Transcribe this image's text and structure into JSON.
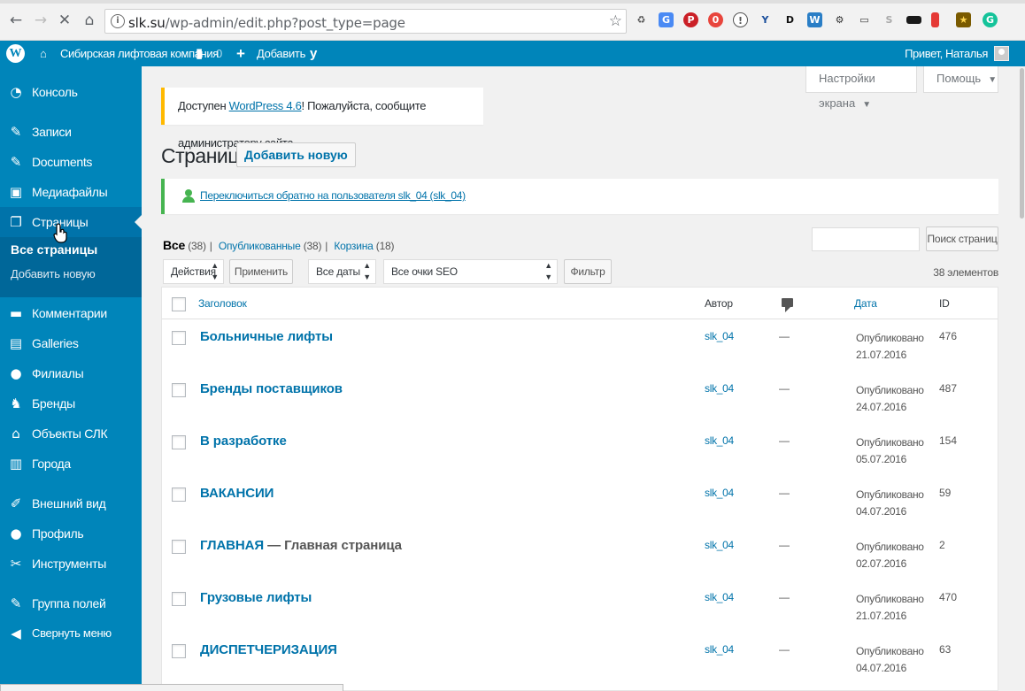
{
  "browser": {
    "url_host": "slk.su",
    "url_path": "/wp-admin/edit.php?post_type=page",
    "back_icon": "arrow-left-icon",
    "forward_icon": "arrow-right-icon",
    "stop_icon": "close-icon",
    "home_icon": "home-icon"
  },
  "adminbar": {
    "site_name": "Сибирская лифтовая компания",
    "comments_count": "0",
    "add_label": "Добавить",
    "greeting": "Привет, Наталья"
  },
  "sidebar": {
    "items": [
      {
        "label": "Консоль",
        "icon": "dashboard-icon"
      },
      {
        "label": "Записи",
        "icon": "pin-icon"
      },
      {
        "label": "Documents",
        "icon": "pin-icon"
      },
      {
        "label": "Медиафайлы",
        "icon": "media-icon"
      },
      {
        "label": "Страницы",
        "icon": "pages-icon"
      },
      {
        "label": "Комментарии",
        "icon": "comment-icon"
      },
      {
        "label": "Galleries",
        "icon": "gallery-icon"
      },
      {
        "label": "Филиалы",
        "icon": "location-icon"
      },
      {
        "label": "Бренды",
        "icon": "brand-icon"
      },
      {
        "label": "Объекты СЛК",
        "icon": "home-icon"
      },
      {
        "label": "Города",
        "icon": "building-icon"
      },
      {
        "label": "Внешний вид",
        "icon": "brush-icon"
      },
      {
        "label": "Профиль",
        "icon": "user-icon"
      },
      {
        "label": "Инструменты",
        "icon": "wrench-icon"
      },
      {
        "label": "Группа полей",
        "icon": "plugin-icon"
      },
      {
        "label": "Свернуть меню",
        "icon": "collapse-icon"
      }
    ],
    "submenu": {
      "all_pages": "Все страницы",
      "add_new": "Добавить новую"
    }
  },
  "screen_options": {
    "screen_label": "Настройки экрана",
    "help_label": "Помощь"
  },
  "update_notice": {
    "prefix": "Доступен ",
    "link": "WordPress 4.6",
    "suffix": "! Пожалуйста, сообщите администратору сайта."
  },
  "page": {
    "title": "Страницы",
    "add_new": "Добавить новую"
  },
  "switch_notice": {
    "link": "Переключиться обратно на пользователя slk_04 (slk_04)",
    "suffix": "."
  },
  "filters": {
    "all": "Все",
    "all_count": "(38)",
    "published": "Опубликованные",
    "published_count": "(38)",
    "trash": "Корзина",
    "trash_count": "(18)",
    "search_button": "Поиск страниц",
    "bulk_action": "Действия",
    "apply": "Применить",
    "dates": "Все даты",
    "seo": "Все очки SEO",
    "filter": "Фильтр",
    "count": "38 элементов"
  },
  "table": {
    "headers": {
      "title": "Заголовок",
      "author": "Автор",
      "date": "Дата",
      "id": "ID"
    },
    "rows": [
      {
        "title": "Больничные лифты",
        "state": "",
        "author": "slk_04",
        "comments": "—",
        "status": "Опубликовано",
        "date": "21.07.2016",
        "id": "476"
      },
      {
        "title": "Бренды поставщиков",
        "state": "",
        "author": "slk_04",
        "comments": "—",
        "status": "Опубликовано",
        "date": "24.07.2016",
        "id": "487"
      },
      {
        "title": "В разработке",
        "state": "",
        "author": "slk_04",
        "comments": "—",
        "status": "Опубликовано",
        "date": "05.07.2016",
        "id": "154"
      },
      {
        "title": "ВАКАНСИИ",
        "state": "",
        "author": "slk_04",
        "comments": "—",
        "status": "Опубликовано",
        "date": "04.07.2016",
        "id": "59"
      },
      {
        "title": "ГЛАВНАЯ",
        "state": " — Главная страница",
        "author": "slk_04",
        "comments": "—",
        "status": "Опубликовано",
        "date": "02.07.2016",
        "id": "2"
      },
      {
        "title": "Грузовые лифты",
        "state": "",
        "author": "slk_04",
        "comments": "—",
        "status": "Опубликовано",
        "date": "21.07.2016",
        "id": "470"
      },
      {
        "title": "ДИСПЕТЧЕРИЗАЦИЯ",
        "state": "",
        "author": "slk_04",
        "comments": "—",
        "status": "Опубликовано",
        "date": "04.07.2016",
        "id": "63"
      }
    ]
  },
  "colors": {
    "admin_blue": "#0085ba",
    "current_blue": "#0073aa",
    "submenu_blue": "#006799",
    "notice_yellow": "#ffb900",
    "notice_green": "#46b450"
  }
}
